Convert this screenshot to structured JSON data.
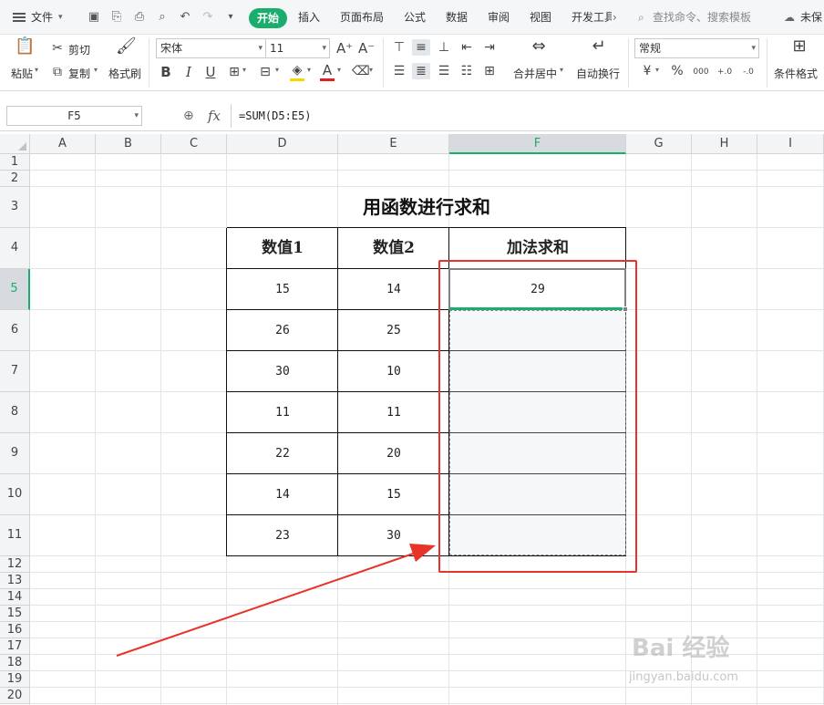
{
  "menu": {
    "file_label": "文件",
    "tabs": [
      "开始",
      "插入",
      "页面布局",
      "公式",
      "数据",
      "审阅",
      "视图",
      "开发工具"
    ],
    "active_tab": "开始",
    "search_placeholder": "查找命令、搜索模板",
    "unsaved_label": "未保"
  },
  "ribbon": {
    "paste": "粘贴",
    "cut": "剪切",
    "copy": "复制",
    "format_painter": "格式刷",
    "font_name": "宋体",
    "font_size": "11",
    "bold": "B",
    "italic": "I",
    "underline": "U",
    "merge_center": "合并居中",
    "wrap_text": "自动换行",
    "number_format": "常规",
    "currency": "¥",
    "percent": "%",
    "thousands": "000",
    "decimal_add": "+.0",
    "decimal_remove": "-.0",
    "conditional_format": "条件格式",
    "font_color": "#e02020",
    "fill_color": "#f5d800",
    "accent": "#1aad6d"
  },
  "formula_bar": {
    "name_box": "F5",
    "fx": "fx",
    "formula": "=SUM(D5:E5)"
  },
  "sheet": {
    "columns": [
      "A",
      "B",
      "C",
      "D",
      "E",
      "F",
      "G",
      "H",
      "I"
    ],
    "rows": [
      "1",
      "2",
      "3",
      "4",
      "5",
      "6",
      "7",
      "8",
      "9",
      "10",
      "11",
      "12",
      "13",
      "14",
      "15",
      "16",
      "17",
      "18",
      "19",
      "20"
    ],
    "selected_column": "F",
    "selected_row": "5",
    "title": "用函数进行求和",
    "headers": [
      "数值1",
      "数值2",
      "加法求和"
    ],
    "data": [
      [
        "15",
        "14",
        "29"
      ],
      [
        "26",
        "25",
        ""
      ],
      [
        "30",
        "10",
        ""
      ],
      [
        "11",
        "11",
        ""
      ],
      [
        "22",
        "20",
        ""
      ],
      [
        "14",
        "15",
        ""
      ],
      [
        "23",
        "30",
        ""
      ]
    ]
  },
  "annotation": {
    "highlight_color": "#e8332a"
  },
  "watermark": {
    "brand": "Bai 经验",
    "url": "jingyan.baidu.com"
  }
}
